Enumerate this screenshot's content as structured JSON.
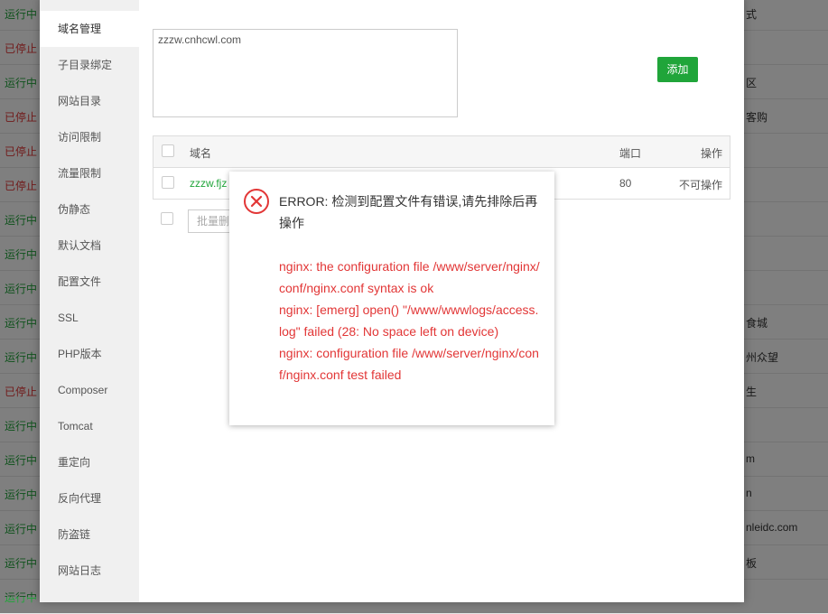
{
  "background": {
    "rows": [
      {
        "status": "运行中",
        "state": "run",
        "right": "式"
      },
      {
        "status": "已停止",
        "state": "stop",
        "right": ""
      },
      {
        "status": "运行中",
        "state": "run",
        "right": "区"
      },
      {
        "status": "已停止",
        "state": "stop",
        "right": "客购"
      },
      {
        "status": "已停止",
        "state": "stop",
        "right": ""
      },
      {
        "status": "已停止",
        "state": "stop",
        "right": ""
      },
      {
        "status": "运行中",
        "state": "run",
        "right": ""
      },
      {
        "status": "运行中",
        "state": "run",
        "right": ""
      },
      {
        "status": "运行中",
        "state": "run",
        "right": ""
      },
      {
        "status": "运行中",
        "state": "run",
        "right": "食城"
      },
      {
        "status": "运行中",
        "state": "run",
        "right": "州众望"
      },
      {
        "status": "已停止",
        "state": "stop",
        "right": "生"
      },
      {
        "status": "运行中",
        "state": "run",
        "right": ""
      },
      {
        "status": "运行中",
        "state": "run",
        "right": "m"
      },
      {
        "status": "运行中",
        "state": "run",
        "right": "n"
      },
      {
        "status": "运行中",
        "state": "run",
        "right": "nleidc.com"
      },
      {
        "status": "运行中",
        "state": "run",
        "right": "板"
      },
      {
        "status": "运行中",
        "state": "run",
        "right": ""
      }
    ]
  },
  "sidebar": {
    "items": [
      {
        "label": "域名管理",
        "active": true
      },
      {
        "label": "子目录绑定"
      },
      {
        "label": "网站目录"
      },
      {
        "label": "访问限制"
      },
      {
        "label": "流量限制"
      },
      {
        "label": "伪静态"
      },
      {
        "label": "默认文档"
      },
      {
        "label": "配置文件"
      },
      {
        "label": "SSL"
      },
      {
        "label": "PHP版本"
      },
      {
        "label": "Composer"
      },
      {
        "label": "Tomcat"
      },
      {
        "label": "重定向"
      },
      {
        "label": "反向代理"
      },
      {
        "label": "防盗链"
      },
      {
        "label": "网站日志"
      }
    ]
  },
  "domain_panel": {
    "textarea_value": "zzzw.cnhcwl.com",
    "add_label": "添加",
    "table": {
      "headers": {
        "domain": "域名",
        "port": "端口",
        "op": "操作"
      },
      "rows": [
        {
          "domain": "zzzw.fjz",
          "port": "80",
          "op": "不可操作"
        }
      ]
    },
    "batch_label": "批量删"
  },
  "dialog": {
    "title": "ERROR: 检测到配置文件有错误,请先排除后再操作",
    "error_lines": [
      "nginx: the configuration file /www/server/nginx/conf/nginx.conf syntax is ok",
      "nginx: [emerg] open() \"/www/wwwlogs/access.log\" failed (28: No space left on device)",
      "nginx: configuration file /www/server/nginx/conf/nginx.conf test failed"
    ],
    "icon": "error-circle-x-icon",
    "accent": "#e23636"
  }
}
